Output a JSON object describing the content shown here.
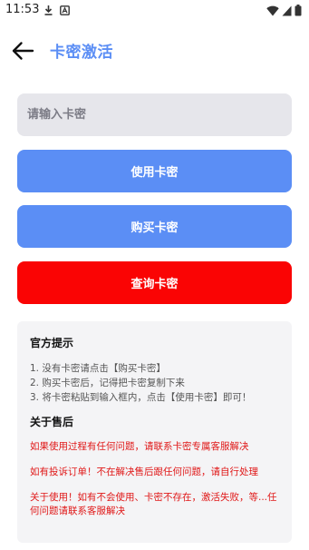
{
  "status_bar": {
    "time": "11:53"
  },
  "header": {
    "title": "卡密激活"
  },
  "input": {
    "placeholder": "请输入卡密",
    "value": ""
  },
  "buttons": {
    "use": "使用卡密",
    "buy": "购买卡密",
    "query": "查询卡密"
  },
  "notice": {
    "title": "官方提示",
    "tips": [
      "1. 没有卡密请点击【购买卡密】",
      "2. 购买卡密后，记得把卡密复制下来",
      "3. 将卡密粘贴到输入框内，点击【使用卡密】即可！"
    ],
    "after_sale_title": "关于售后",
    "after_sale_lines": [
      "如果使用过程有任何问题，请联系卡密专属客服解决",
      "如有投诉订单！不在解决售后跟任何问题，请自行处理",
      "关于使用！如有不会使用、卡密不存在，激活失败，等...任何问题请联系客服解决"
    ]
  },
  "colors": {
    "accent": "#5b8ef5",
    "danger": "#fa0404",
    "notice_text_red": "#e01818",
    "input_bg": "#e6e6eb",
    "panel_bg": "#f4f4f6"
  }
}
